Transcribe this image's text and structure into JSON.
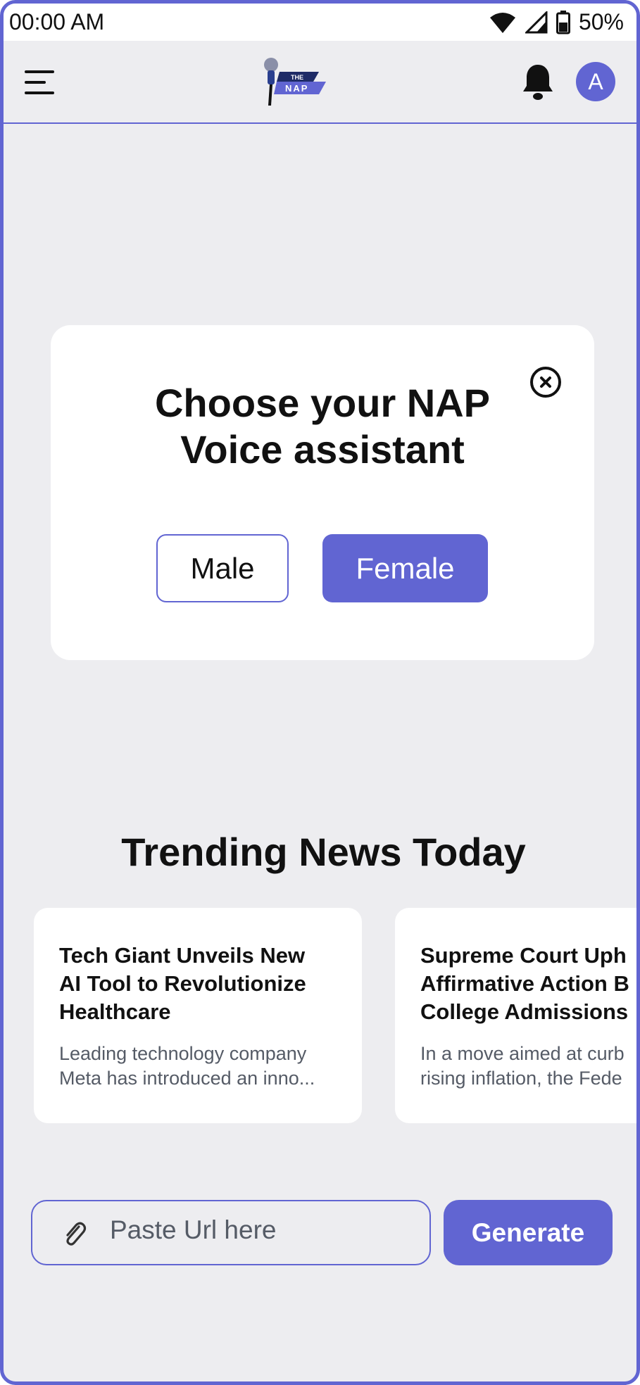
{
  "status_bar": {
    "time": "00:00 AM",
    "battery": "50%"
  },
  "header": {
    "avatar_initial": "A",
    "logo_alt": "THE NAP"
  },
  "modal": {
    "title_line1": "Choose your NAP",
    "title_line2": "Voice assistant",
    "male_label": "Male",
    "female_label": "Female"
  },
  "trending": {
    "title": "Trending News Today",
    "cards": [
      {
        "title": "Tech Giant Unveils New\nAI Tool to Revolutionize\nHealthcare",
        "description": "Leading technology company\nMeta has introduced an inno..."
      },
      {
        "title": "Supreme Court Uph\nAffirmative Action B\nCollege Admissions",
        "description": "In a move aimed at curb\nrising inflation, the Fede"
      }
    ]
  },
  "url_input": {
    "placeholder": "Paste Url here"
  },
  "generate_label": "Generate",
  "colors": {
    "accent": "#6165d2",
    "background": "#ededf0",
    "card": "#ffffff",
    "text": "#111111",
    "muted_text": "#555b66"
  },
  "icons": [
    "wifi-icon",
    "signal-icon",
    "battery-icon",
    "menu-icon",
    "bell-icon",
    "close-icon",
    "paperclip-icon"
  ]
}
